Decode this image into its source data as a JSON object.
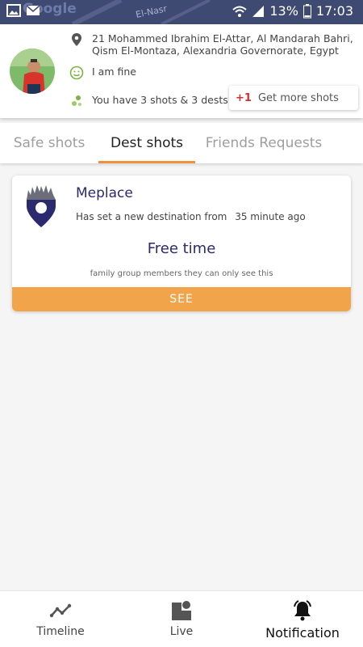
{
  "statusbar": {
    "battery": "13%",
    "time": "17:03",
    "map_label": "El-Nasr",
    "map_brand": "Google"
  },
  "profile": {
    "address": "21 Mohammed Ibrahim El-Attar, Al Mandarah Bahri, Qism El-Montaza, Alexandria Governorate, Egypt",
    "status": "I am fine",
    "shots_info": "You have 3 shots & 3 dests",
    "more_shots_prefix": "+1",
    "more_shots_label": "Get more shots"
  },
  "tabs": [
    {
      "label": "Safe shots"
    },
    {
      "label": "Dest shots"
    },
    {
      "label": "Friends Requests"
    }
  ],
  "active_tab": "Dest shots",
  "card": {
    "title": "Meplace",
    "subtitle": "Has set a new destination from",
    "time_ago": "35 minute ago",
    "heading": "Free time",
    "note": "family group members they can only see this",
    "button": "SEE"
  },
  "bottom_nav": [
    {
      "label": "Timeline",
      "icon": "timeline-icon"
    },
    {
      "label": "Live",
      "icon": "live-icon"
    },
    {
      "label": "Notification",
      "icon": "bell-icon"
    }
  ],
  "colors": {
    "accent": "#f0923a",
    "see_button": "#f2a44a",
    "title_navy": "#2b2a6e",
    "status_bar": "#3f4a72",
    "plus_red": "#d32f2f",
    "status_green": "#7cb342"
  }
}
